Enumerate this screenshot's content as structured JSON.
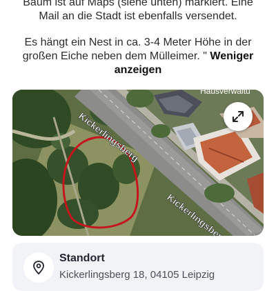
{
  "description": {
    "line1": "Baum ist auf Maps (siehe unten) markiert. Eine",
    "line2": "Mail an die Stadt ist ebenfalls versendet.",
    "line3": "Es hängt ein Nest in ca. 3-4 Meter Höhe in der",
    "line4_text": "großen Eiche neben dem Mülleimer. \"",
    "line4_link": "Weniger",
    "line5_link": "anzeigen"
  },
  "map": {
    "street_label_1": "Kickerlingsberg",
    "street_label_2": "Kickerlingsberg",
    "poi_label": "Hausverwaltu",
    "marker_color": "#c4161c",
    "expand_icon": "expand-arrows-icon"
  },
  "location_card": {
    "title": "Standort",
    "address": "Kickerlingsberg 18, 04105 Leipzig",
    "icon": "location-pin-icon"
  }
}
